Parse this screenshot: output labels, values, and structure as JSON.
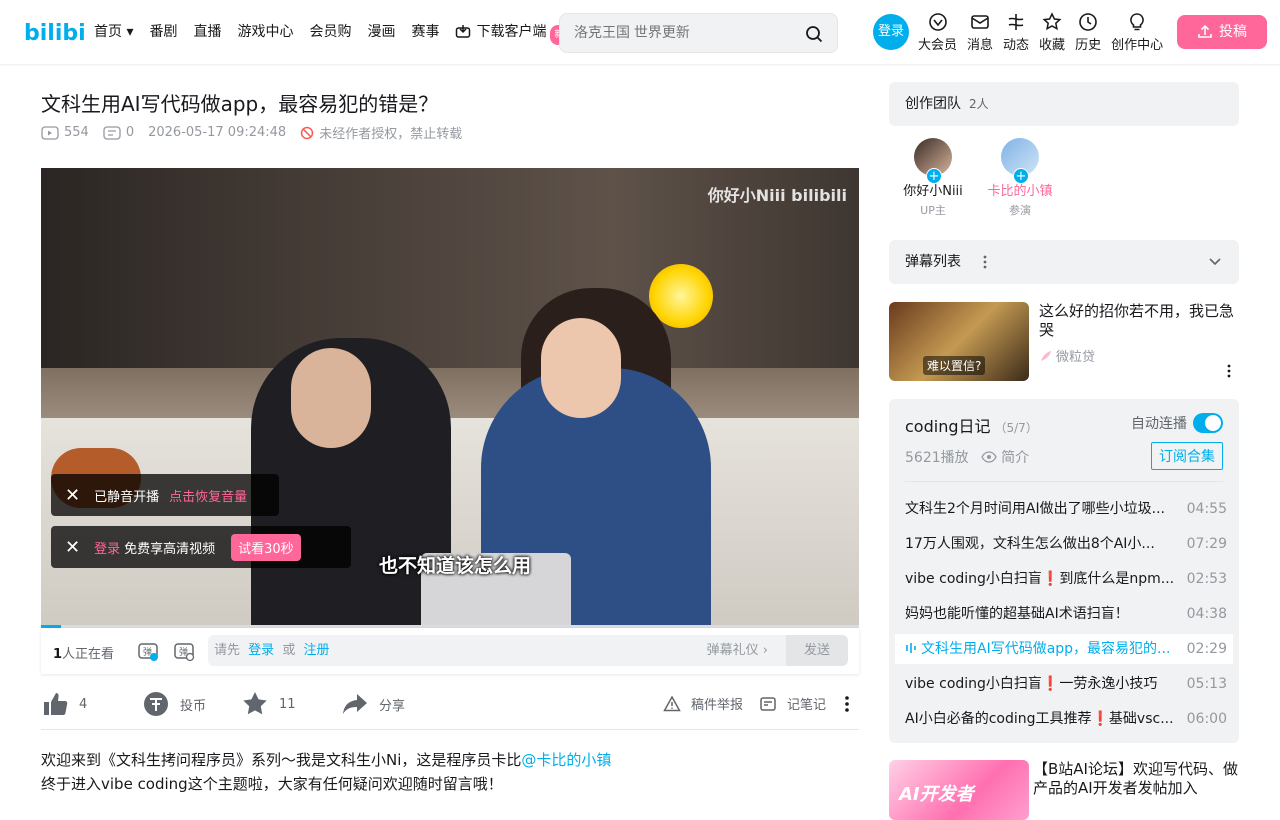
{
  "header": {
    "logo": "bilibili",
    "nav": [
      "首页",
      "番剧",
      "直播",
      "游戏中心",
      "会员购",
      "漫画",
      "赛事"
    ],
    "download": "下载客户端",
    "new_badge": "新",
    "search_placeholder": "洛克王国 世界更新",
    "login": "登录",
    "icons": [
      "大会员",
      "消息",
      "动态",
      "收藏",
      "历史",
      "创作中心"
    ],
    "upload": "投稿"
  },
  "video": {
    "title": "文科生用AI写代码做app，最容易犯的错是？",
    "views": "554",
    "danmaku_count": "0",
    "date": "2026-05-17 09:24:48",
    "copyright": "未经作者授权，禁止转载",
    "watermark": "你好小Niii bilibili",
    "subtitle": "也不知道该怎么用",
    "progress": 0.025,
    "toast1": {
      "text": "已静音开播",
      "action": "点击恢复音量"
    },
    "toast2": {
      "login": "登录",
      "text": "免费享高清视频",
      "try": "试看30秒"
    }
  },
  "danmaku_bar": {
    "viewers_num": "1",
    "viewers_text": "人正在看",
    "input_prefix": "请先",
    "login": "登录",
    "or": "或",
    "register": "注册",
    "gift": "弹幕礼仪",
    "send": "发送"
  },
  "actions": {
    "like": "4",
    "coin": "投币",
    "fav": "11",
    "share": "分享",
    "report": "稿件举报",
    "notes": "记笔记"
  },
  "description": {
    "line1": "欢迎来到《文科生拷问程序员》系列～我是文科生小Ni，这是程序员卡比",
    "mention": "@卡比的小镇",
    "line2": "终于进入vibe coding这个主题啦，大家有任何疑问欢迎随时留言哦！"
  },
  "team": {
    "title": "创作团队",
    "count": "2人",
    "members": [
      {
        "name": "你好小Niii",
        "role": "UP主"
      },
      {
        "name": "卡比的小镇",
        "role": "参演"
      }
    ]
  },
  "danmaku_list": {
    "title": "弹幕列表"
  },
  "ad": {
    "title": "这么好的招你若不用，我已急哭",
    "source": "微粒贷",
    "thumb_text": "难以置信?"
  },
  "playlist": {
    "title": "coding日记",
    "progress": "（5/7）",
    "autoplay": "自动连播",
    "plays": "5621播放",
    "intro": "简介",
    "subscribe": "订阅合集",
    "items": [
      {
        "title": "文科生2个月时间用AI做出了哪些小垃圾...",
        "duration": "04:55"
      },
      {
        "title": "17万人围观，文科生怎么做出8个AI小...",
        "duration": "07:29"
      },
      {
        "title": "vibe coding小白扫盲❗到底什么是npm...",
        "duration": "02:53"
      },
      {
        "title": "妈妈也能听懂的超基础AI术语扫盲！",
        "duration": "04:38"
      },
      {
        "title": "文科生用AI写代码做app，最容易犯的...",
        "duration": "02:29"
      },
      {
        "title": "vibe coding小白扫盲❗一劳永逸小技巧",
        "duration": "05:13"
      },
      {
        "title": "AI小白必备的coding工具推荐❗基础vsc...",
        "duration": "06:00"
      }
    ]
  },
  "ad2": {
    "title": "【B站AI论坛】欢迎写代码、做产品的AI开发者发帖加入",
    "thumb_text": "AI开发者"
  },
  "colors": {
    "accent": "#00aeec",
    "pink": "#ff6699"
  }
}
